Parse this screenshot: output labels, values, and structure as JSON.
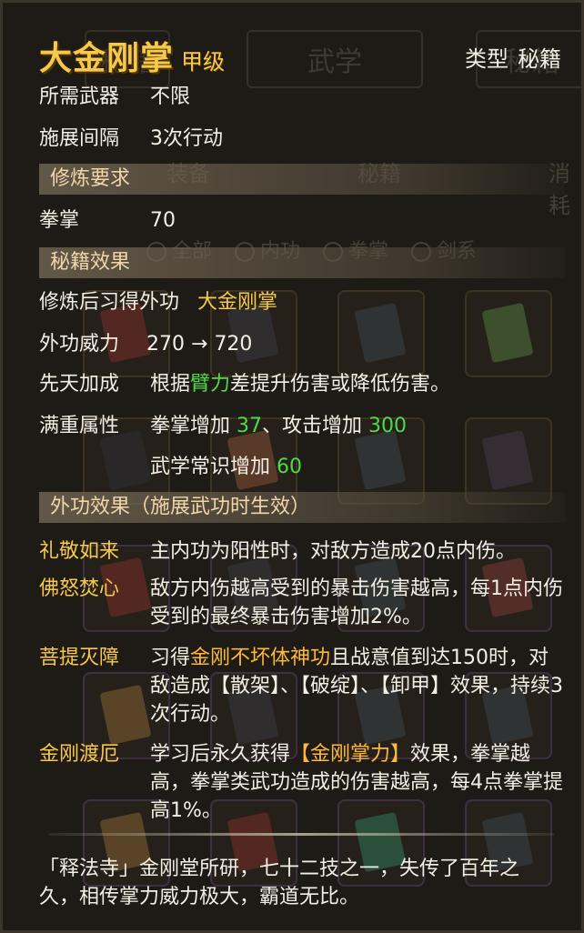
{
  "skill": {
    "name": "大金刚掌",
    "grade": "甲级",
    "type_label": "类型",
    "type_value": "秘籍"
  },
  "basic": {
    "weapon_label": "所需武器",
    "weapon_value": "不限",
    "interval_label": "施展间隔",
    "interval_value": "3次行动"
  },
  "requirements": {
    "header": "修炼要求",
    "stat_label": "拳掌",
    "stat_value": "70"
  },
  "effects": {
    "header": "秘籍效果",
    "learn_label": "修炼后习得外功",
    "learn_value": "大金刚掌",
    "power_label": "外功威力",
    "power_from": "270",
    "power_arrow": "→",
    "power_to": "720",
    "innate_label": "先天加成",
    "innate_pre": "根据",
    "innate_stat": "臂力",
    "innate_post": "差提升伤害或降低伤害。",
    "full_label": "满重属性",
    "full_line1_a": "拳掌增加",
    "full_line1_a_val": "37",
    "full_line1_sep": "、攻击增加",
    "full_line1_b_val": "300",
    "full_line2_a": "武学常识增加",
    "full_line2_a_val": "60"
  },
  "outer": {
    "header": "外功效果（施展武功时生效）",
    "items": [
      {
        "name": "礼敬如来",
        "text": "主内功为阳性时，对敌方造成20点内伤。"
      },
      {
        "name": "佛怒焚心",
        "text": "敌方内伤越高受到的暴击伤害越高，每1点内伤受到的最终暴击伤害增加2%。"
      },
      {
        "name": "菩提灭障",
        "pre": "习得",
        "highlight": "金刚不坏体神功",
        "post": "且战意值到达150时，对敌造成【散架】、【破绽】、【卸甲】效果，持续3次行动。"
      },
      {
        "name": "金刚渡厄",
        "pre": "学习后永久获得",
        "highlight": "【金刚掌力】",
        "post": "效果，拳掌越高，拳掌类武功造成的伤害越高，每4点拳掌提高1%。"
      }
    ]
  },
  "lore": "「释法寺」金刚堂所研，七十二技之一，失传了百年之久，相传掌力威力极大，霸道无比。",
  "background": {
    "tabs": [
      "秘籍",
      "武学",
      "秘籍"
    ],
    "categories": [
      "装备",
      "秘籍",
      "消耗"
    ],
    "filters": [
      "全部",
      "内功",
      "拳掌",
      "剑系"
    ]
  },
  "colors": {
    "gold": "#f6c94a",
    "green": "#4fd94a",
    "orange": "#ffb93a",
    "text": "#f4efe4"
  }
}
